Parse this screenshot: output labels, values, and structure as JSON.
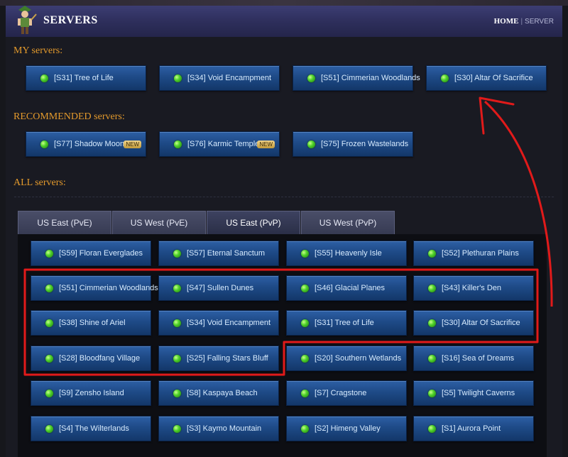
{
  "header": {
    "title": "SERVERS",
    "breadcrumb_home": "HOME",
    "breadcrumb_separator": "|",
    "breadcrumb_current": "SERVER",
    "avatar_icon": "character-avatar-icon"
  },
  "sections": {
    "my": "MY servers:",
    "recommended": "RECOMMENDED servers:",
    "all": "ALL servers:"
  },
  "colors": {
    "section_title": "#e49a2c",
    "server_button": "#1e4a87",
    "status_online": "#4fd22b",
    "annotation": "#e11a1a"
  },
  "my_servers": [
    {
      "label": "[S31] Tree of Life",
      "status": "online"
    },
    {
      "label": "[S34] Void Encampment",
      "status": "online"
    },
    {
      "label": "[S51] Cimmerian Woodlands",
      "status": "online"
    },
    {
      "label": "[S30] Altar Of Sacrifice",
      "status": "online"
    }
  ],
  "recommended_servers": [
    {
      "label": "[S77] Shadow Moon",
      "badge": "NEW",
      "status": "online"
    },
    {
      "label": "[S76] Karmic Temple",
      "badge": "NEW",
      "status": "online"
    },
    {
      "label": "[S75] Frozen Wastelands",
      "status": "online"
    }
  ],
  "tabs": [
    {
      "label": "US East (PvE)",
      "active": false
    },
    {
      "label": "US West (PvE)",
      "active": false
    },
    {
      "label": "US East (PvP)",
      "active": true
    },
    {
      "label": "US West (PvP)",
      "active": false
    }
  ],
  "all_servers": [
    "[S59] Floran Everglades",
    "[S57] Eternal Sanctum",
    "[S55] Heavenly Isle",
    "[S52] Plethuran Plains",
    "[S51] Cimmerian Woodlands",
    "[S47] Sullen Dunes",
    "[S46] Glacial Planes",
    "[S43] Killer's Den",
    "[S38] Shine of Ariel",
    "[S34] Void Encampment",
    "[S31] Tree of Life",
    "[S30] Altar Of Sacrifice",
    "[S28] Bloodfang Village",
    "[S25] Falling Stars Bluff",
    "[S20] Southern Wetlands",
    "[S16] Sea of Dreams",
    "[S9] Zensho Island",
    "[S8] Kaspaya Beach",
    "[S7] Cragstone",
    "[S5] Twilight Caverns",
    "[S4] The Wilterlands",
    "[S3] Kaymo Mountain",
    "[S2] Himeng Valley",
    "[S1] Aurora Point"
  ]
}
